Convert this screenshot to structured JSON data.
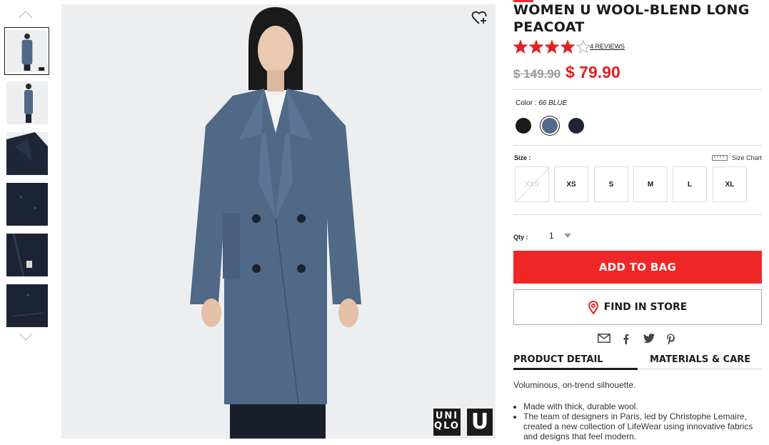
{
  "product": {
    "title": "WOMEN U WOOL-BLEND LONG PEACOAT",
    "rating": 4,
    "rating_max": 5,
    "reviews_link": "4 REVIEWS",
    "price_original": "$ 149.90",
    "price_sale": "$ 79.90"
  },
  "color": {
    "label": "Color :",
    "value": "66 BLUE",
    "swatches": [
      {
        "name": "black",
        "hex": "#1b1b1b",
        "selected": false
      },
      {
        "name": "blue",
        "hex": "#556b8a",
        "selected": true
      },
      {
        "name": "navy",
        "hex": "#1f2533",
        "selected": false
      }
    ]
  },
  "size": {
    "label": "Size :",
    "chart_link": "Size Chart",
    "options": [
      {
        "label": "XXS",
        "available": false
      },
      {
        "label": "XS",
        "available": true
      },
      {
        "label": "S",
        "available": true
      },
      {
        "label": "M",
        "available": true
      },
      {
        "label": "L",
        "available": true
      },
      {
        "label": "XL",
        "available": true
      }
    ]
  },
  "quantity": {
    "label": "Qty :",
    "value": "1"
  },
  "buttons": {
    "add_to_bag": "ADD TO BAG",
    "find_in_store": "FIND IN STORE"
  },
  "share_icons": [
    "email-icon",
    "facebook-icon",
    "twitter-icon",
    "pinterest-icon"
  ],
  "tabs": {
    "product_detail": "PRODUCT DETAIL",
    "materials_care": "MATERIALS & CARE"
  },
  "detail": {
    "summary": "Voluminous, on-trend silhouette.",
    "bullets": [
      "Made with thick, durable wool.",
      "The team of designers in Paris, led by Christophe Lemaire, created a new collection of LifeWear using innovative fabrics and designs that feel modern."
    ]
  },
  "brand": {
    "logo_text_line1": "UNI",
    "logo_text_line2": "QLO",
    "logo_u": "U"
  },
  "colors": {
    "accent_red": "#f02727",
    "sale_red": "#e22020",
    "coat_blue": "#4f6987"
  }
}
